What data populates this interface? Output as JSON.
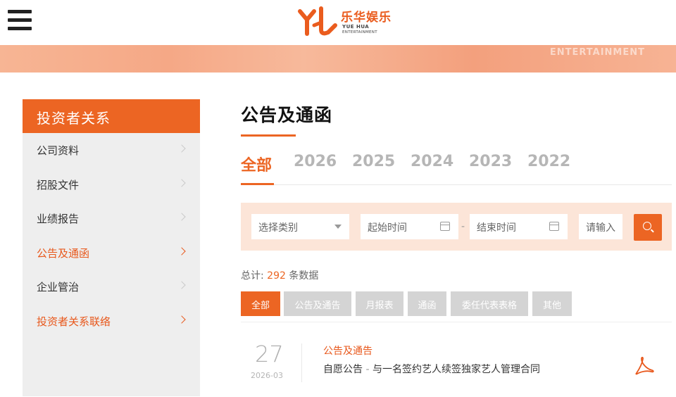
{
  "header": {
    "logo_cn": "乐华娱乐",
    "logo_en1": "YUE HUA",
    "logo_en2": "ENTERTAINMENT"
  },
  "banner": {
    "text": "ENTERTAINMENT"
  },
  "sidebar": {
    "title": "投资者关系",
    "items": [
      {
        "label": "公司资料"
      },
      {
        "label": "招股文件"
      },
      {
        "label": "业绩报告"
      },
      {
        "label": "公告及通函"
      },
      {
        "label": "企业管治"
      },
      {
        "label": "投资者关系联络"
      }
    ]
  },
  "main": {
    "title": "公告及通函",
    "year_tabs": [
      "全部",
      "2026",
      "2025",
      "2024",
      "2023",
      "2022"
    ],
    "filters": {
      "category_placeholder": "选择类别",
      "start_placeholder": "起始时间",
      "dash": "-",
      "end_placeholder": "结束时间",
      "keyword_placeholder": "请输入"
    },
    "total": {
      "prefix": "总计: ",
      "count": "292",
      "suffix": " 条数据"
    },
    "categories": [
      "全部",
      "公告及通告",
      "月报表",
      "通函",
      "委任代表表格",
      "其他"
    ],
    "items": [
      {
        "day": "27",
        "year_month": "2026-03",
        "category": "公告及通告",
        "title_a": "自愿公告",
        "title_sep": " - ",
        "title_b": "与一名签约艺人续签独家艺人管理合同"
      }
    ]
  },
  "colors": {
    "accent": "#ec6523",
    "sidebar_bg": "#eeeeee",
    "filter_bg": "#fce5d8",
    "inactive_tab": "#b6b6b6"
  }
}
